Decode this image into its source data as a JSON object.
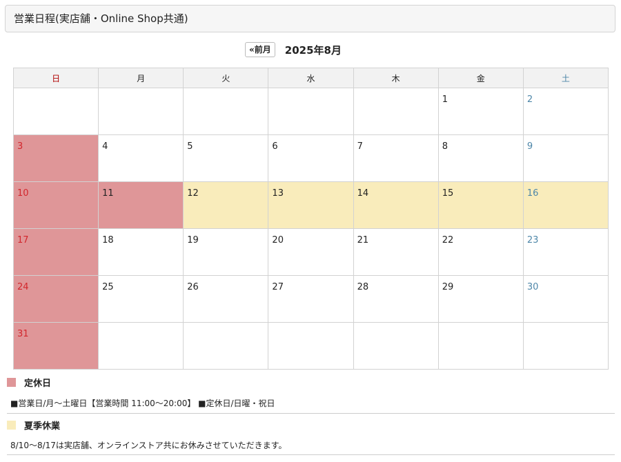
{
  "header": {
    "title": "営業日程(実店舗・Online Shop共通)"
  },
  "nav": {
    "prev_label": "«前月",
    "month_title": "2025年8月"
  },
  "weekdays": [
    "日",
    "月",
    "火",
    "水",
    "木",
    "金",
    "土"
  ],
  "weeks": [
    [
      {
        "d": ""
      },
      {
        "d": ""
      },
      {
        "d": ""
      },
      {
        "d": ""
      },
      {
        "d": ""
      },
      {
        "d": "1"
      },
      {
        "d": "2"
      }
    ],
    [
      {
        "d": "3",
        "s": "closed"
      },
      {
        "d": "4"
      },
      {
        "d": "5"
      },
      {
        "d": "6"
      },
      {
        "d": "7"
      },
      {
        "d": "8"
      },
      {
        "d": "9"
      }
    ],
    [
      {
        "d": "10",
        "s": "closed"
      },
      {
        "d": "11",
        "s": "closed"
      },
      {
        "d": "12",
        "s": "summer"
      },
      {
        "d": "13",
        "s": "summer"
      },
      {
        "d": "14",
        "s": "summer"
      },
      {
        "d": "15",
        "s": "summer"
      },
      {
        "d": "16",
        "s": "summer"
      }
    ],
    [
      {
        "d": "17",
        "s": "closed"
      },
      {
        "d": "18"
      },
      {
        "d": "19"
      },
      {
        "d": "20"
      },
      {
        "d": "21"
      },
      {
        "d": "22"
      },
      {
        "d": "23"
      }
    ],
    [
      {
        "d": "24",
        "s": "closed"
      },
      {
        "d": "25"
      },
      {
        "d": "26"
      },
      {
        "d": "27"
      },
      {
        "d": "28"
      },
      {
        "d": "29"
      },
      {
        "d": "30"
      }
    ],
    [
      {
        "d": "31",
        "s": "closed"
      },
      {
        "d": ""
      },
      {
        "d": ""
      },
      {
        "d": ""
      },
      {
        "d": ""
      },
      {
        "d": ""
      },
      {
        "d": ""
      }
    ]
  ],
  "legend": {
    "closed": {
      "label": "定休日",
      "color": "#df9698",
      "note": "■営業日/月～土曜日【営業時間 11:00～20:00】 ■定休日/日曜・祝日"
    },
    "summer": {
      "label": "夏季休業",
      "color": "#f9ecbb",
      "note": "8/10～8/17は実店舗、オンラインストア共にお休みさせていただきます。"
    }
  }
}
